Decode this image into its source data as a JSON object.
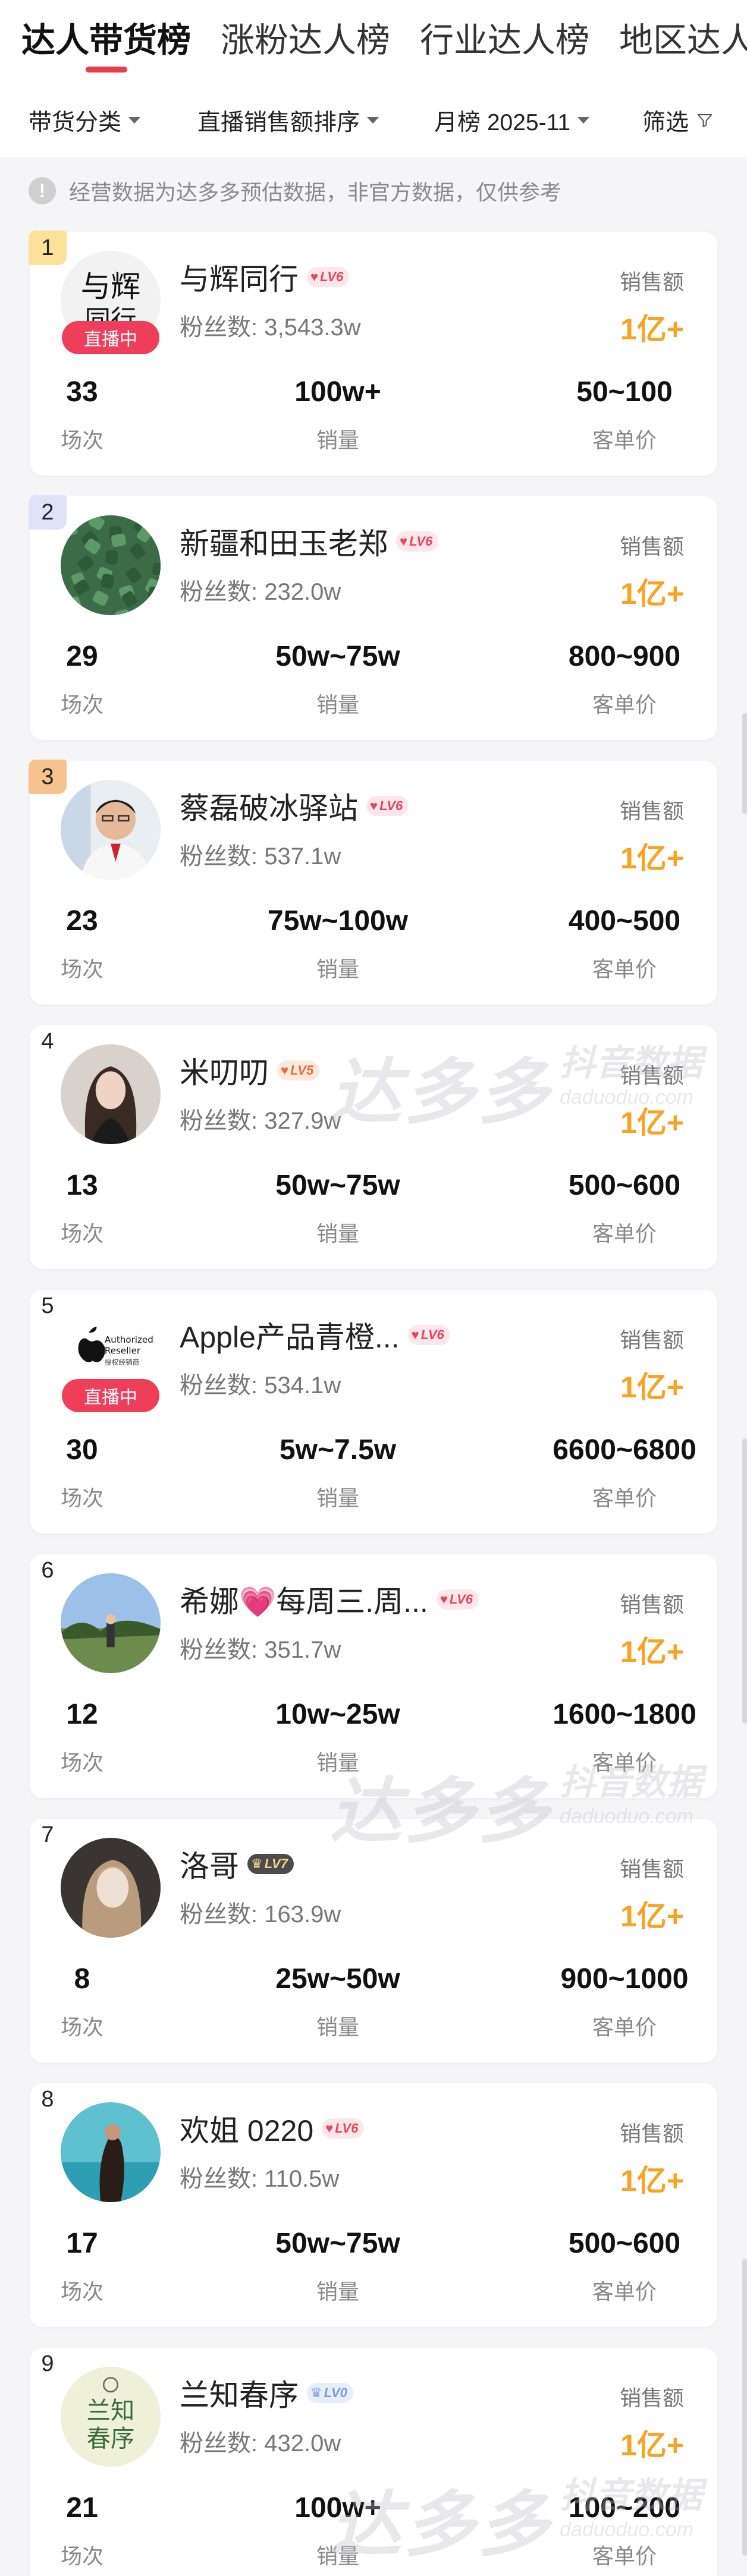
{
  "tabs": [
    "达人带货榜",
    "涨粉达人榜",
    "行业达人榜",
    "地区达人榜"
  ],
  "filters": {
    "category": "带货分类",
    "sort": "直播销售额排序",
    "period": "月榜 2025-11",
    "screen": "筛选"
  },
  "notice": "经营数据为达多多预估数据，非官方数据，仅供参考",
  "labels": {
    "sales": "销售额",
    "sessions": "场次",
    "volume": "销量",
    "unit_price": "客单价",
    "fans_prefix": "粉丝数: ",
    "live": "直播中"
  },
  "watermark": {
    "brand": "达多多",
    "cn": "抖音数据",
    "en": "daduoduo.com"
  },
  "items": [
    {
      "rank": "1",
      "name": "与辉同行",
      "level": "LV6",
      "level_style": "red",
      "fans": "3,543.3w",
      "sales": "1亿+",
      "sessions": "33",
      "volume": "100w+",
      "price": "50~100",
      "live": true,
      "avatar": "text-brush"
    },
    {
      "rank": "2",
      "name": "新疆和田玉老郑",
      "level": "LV6",
      "level_style": "red",
      "fans": "232.0w",
      "sales": "1亿+",
      "sessions": "29",
      "volume": "50w~75w",
      "price": "800~900",
      "live": false,
      "avatar": "jade"
    },
    {
      "rank": "3",
      "name": "蔡磊破冰驿站",
      "level": "LV6",
      "level_style": "red",
      "fans": "537.1w",
      "sales": "1亿+",
      "sessions": "23",
      "volume": "75w~100w",
      "price": "400~500",
      "live": false,
      "avatar": "man"
    },
    {
      "rank": "4",
      "name": "米叨叨",
      "level": "LV5",
      "level_style": "orange",
      "fans": "327.9w",
      "sales": "1亿+",
      "sessions": "13",
      "volume": "50w~75w",
      "price": "500~600",
      "live": false,
      "avatar": "woman-dark"
    },
    {
      "rank": "5",
      "name": "Apple产品青橙...",
      "level": "LV6",
      "level_style": "red",
      "fans": "534.1w",
      "sales": "1亿+",
      "sessions": "30",
      "volume": "5w~7.5w",
      "price": "6600~6800",
      "live": true,
      "avatar": "apple"
    },
    {
      "rank": "6",
      "name": "希娜💗每周三.周...",
      "level": "LV6",
      "level_style": "red",
      "fans": "351.7w",
      "sales": "1亿+",
      "sessions": "12",
      "volume": "10w~25w",
      "price": "1600~1800",
      "live": false,
      "avatar": "outdoor"
    },
    {
      "rank": "7",
      "name": "洛哥",
      "level": "LV7",
      "level_style": "gray",
      "fans": "163.9w",
      "sales": "1亿+",
      "sessions": "8",
      "volume": "25w~50w",
      "price": "900~1000",
      "live": false,
      "avatar": "woman-light"
    },
    {
      "rank": "8",
      "name": "欢姐 0220",
      "level": "LV6",
      "level_style": "red",
      "fans": "110.5w",
      "sales": "1亿+",
      "sessions": "17",
      "volume": "50w~75w",
      "price": "500~600",
      "live": false,
      "avatar": "beach"
    },
    {
      "rank": "9",
      "name": "兰知春序",
      "level": "LV0",
      "level_style": "blue",
      "fans": "432.0w",
      "sales": "1亿+",
      "sessions": "21",
      "volume": "100w+",
      "price": "100~200",
      "live": false,
      "avatar": "lanzhi"
    }
  ]
}
